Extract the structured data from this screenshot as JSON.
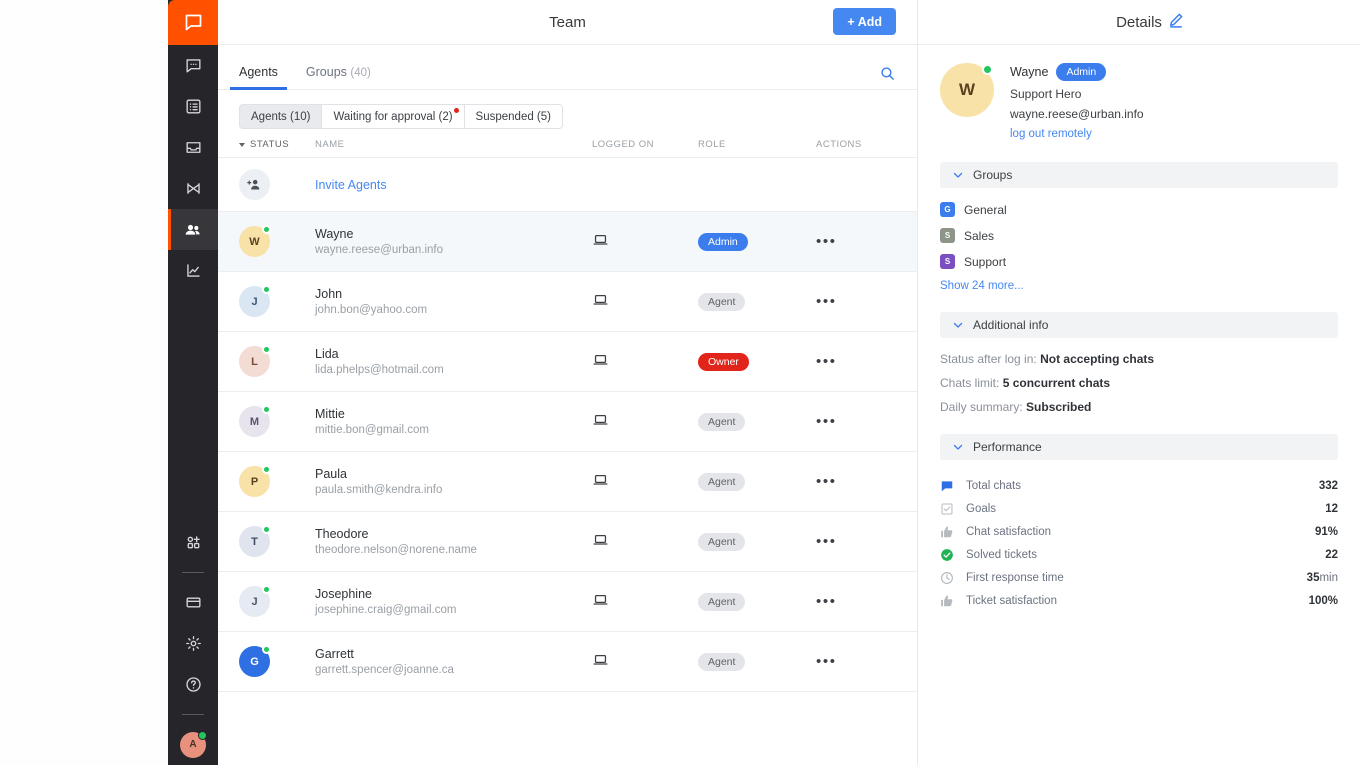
{
  "sidebar": {
    "logo": "livechat-logo-icon",
    "items": [
      {
        "icon": "chats-icon",
        "name": "chats",
        "active": false
      },
      {
        "icon": "tickets-icon",
        "name": "tickets",
        "active": false
      },
      {
        "icon": "archives-icon",
        "name": "archives",
        "active": false
      },
      {
        "icon": "engage-icon",
        "name": "engage",
        "active": false
      },
      {
        "icon": "team-icon",
        "name": "team",
        "active": true
      },
      {
        "icon": "reports-icon",
        "name": "reports",
        "active": false
      }
    ],
    "bottom_items": [
      {
        "icon": "apps-icon",
        "name": "apps"
      },
      {
        "icon": "billing-icon",
        "name": "billing"
      },
      {
        "icon": "settings-icon",
        "name": "settings"
      },
      {
        "icon": "help-icon",
        "name": "help"
      }
    ],
    "account_avatar": {
      "initials": "A",
      "color": "#e8917d",
      "status": "online"
    }
  },
  "header": {
    "title": "Team",
    "add_label": "+ Add"
  },
  "tabs": [
    {
      "label": "Agents",
      "count": "",
      "active": true
    },
    {
      "label": "Groups",
      "count": "(40)",
      "active": false
    }
  ],
  "search": {
    "icon": "search-icon"
  },
  "filters": [
    {
      "label": "Agents (10)",
      "active": true,
      "badge": false
    },
    {
      "label": "Waiting for approval (2)",
      "active": false,
      "badge": true
    },
    {
      "label": "Suspended (5)",
      "active": false,
      "badge": false
    }
  ],
  "table": {
    "columns": [
      "STATUS",
      "NAME",
      "LOGGED ON",
      "ROLE",
      "ACTIONS"
    ],
    "invite_label": "Invite Agents",
    "rows": [
      {
        "name": "Wayne",
        "email": "wayne.reese@urban.info",
        "initials": "W",
        "color": "#f8e2a8",
        "text_color": "#5a4220",
        "status": "online",
        "logged_on": "desktop-icon",
        "role": "Admin",
        "role_class": "admin",
        "selected": true
      },
      {
        "name": "John",
        "email": "john.bon@yahoo.com",
        "initials": "J",
        "color": "#dbe6f3",
        "text_color": "#3b5570",
        "status": "online",
        "logged_on": "desktop-icon",
        "role": "Agent",
        "role_class": "agent",
        "selected": false
      },
      {
        "name": "Lida",
        "email": "lida.phelps@hotmail.com",
        "initials": "L",
        "color": "#f2dcd4",
        "text_color": "#7a4a38",
        "status": "online",
        "logged_on": "desktop-icon",
        "role": "Owner",
        "role_class": "owner",
        "selected": false
      },
      {
        "name": "Mittie",
        "email": "mittie.bon@gmail.com",
        "initials": "M",
        "color": "#e8e4ee",
        "text_color": "#5d5270",
        "status": "online",
        "logged_on": "desktop-icon",
        "role": "Agent",
        "role_class": "agent",
        "selected": false
      },
      {
        "name": "Paula",
        "email": "paula.smith@kendra.info",
        "initials": "P",
        "color": "#f8e2a8",
        "text_color": "#5a4220",
        "status": "online",
        "logged_on": "desktop-icon",
        "role": "Agent",
        "role_class": "agent",
        "selected": false
      },
      {
        "name": "Theodore",
        "email": "theodore.nelson@norene.name",
        "initials": "T",
        "color": "#dfe4ef",
        "text_color": "#3f4b63",
        "status": "online",
        "logged_on": "desktop-icon",
        "role": "Agent",
        "role_class": "agent",
        "selected": false
      },
      {
        "name": "Josephine",
        "email": "josephine.craig@gmail.com",
        "initials": "J",
        "color": "#e6eaf2",
        "text_color": "#4a5568",
        "status": "online",
        "logged_on": "desktop-icon",
        "role": "Agent",
        "role_class": "agent",
        "selected": false
      },
      {
        "name": "Garrett",
        "email": "garrett.spencer@joanne.ca",
        "initials": "G",
        "color": "#2f6fe4",
        "text_color": "#ffffff",
        "status": "online",
        "logged_on": "desktop-icon",
        "role": "Agent",
        "role_class": "agent",
        "selected": false
      }
    ]
  },
  "details": {
    "title": "Details",
    "edit_icon": "edit-pencil-icon",
    "profile": {
      "name": "Wayne",
      "badge": "Admin",
      "subtitle": "Support Hero",
      "email": "wayne.reese@urban.info",
      "logout_link": "log out remotely",
      "initials": "W",
      "avatar_color": "#f8e2a8"
    },
    "groups_section": {
      "title": "Groups",
      "items": [
        {
          "name": "General",
          "letter": "G",
          "color": "#3b7ded"
        },
        {
          "name": "Sales",
          "letter": "S",
          "color": "#8d9488"
        },
        {
          "name": "Support",
          "letter": "S",
          "color": "#7b4fc0"
        }
      ],
      "show_more": "Show 24 more..."
    },
    "additional_info": {
      "title": "Additional info",
      "rows": [
        {
          "label": "Status after log in:",
          "value": "Not accepting chats"
        },
        {
          "label": "Chats limit:",
          "value": "5 concurrent chats"
        },
        {
          "label": "Daily summary:",
          "value": "Subscribed"
        }
      ]
    },
    "performance": {
      "title": "Performance",
      "rows": [
        {
          "icon": "chat-bubble-icon",
          "color": "#2f6fe4",
          "label": "Total chats",
          "value": "332",
          "unit": ""
        },
        {
          "icon": "checkbox-icon",
          "color": "#c4c9d0",
          "label": "Goals",
          "value": "12",
          "unit": ""
        },
        {
          "icon": "thumbs-up-icon",
          "color": "#b5bac1",
          "label": "Chat satisfaction",
          "value": "91%",
          "unit": ""
        },
        {
          "icon": "check-circle-icon",
          "color": "#20b255",
          "label": "Solved tickets",
          "value": "22",
          "unit": ""
        },
        {
          "icon": "clock-icon",
          "color": "#b5bac1",
          "label": "First response time",
          "value": "35",
          "unit": " min"
        },
        {
          "icon": "thumbs-up-icon",
          "color": "#b5bac1",
          "label": "Ticket satisfaction",
          "value": "100%",
          "unit": ""
        }
      ]
    }
  }
}
